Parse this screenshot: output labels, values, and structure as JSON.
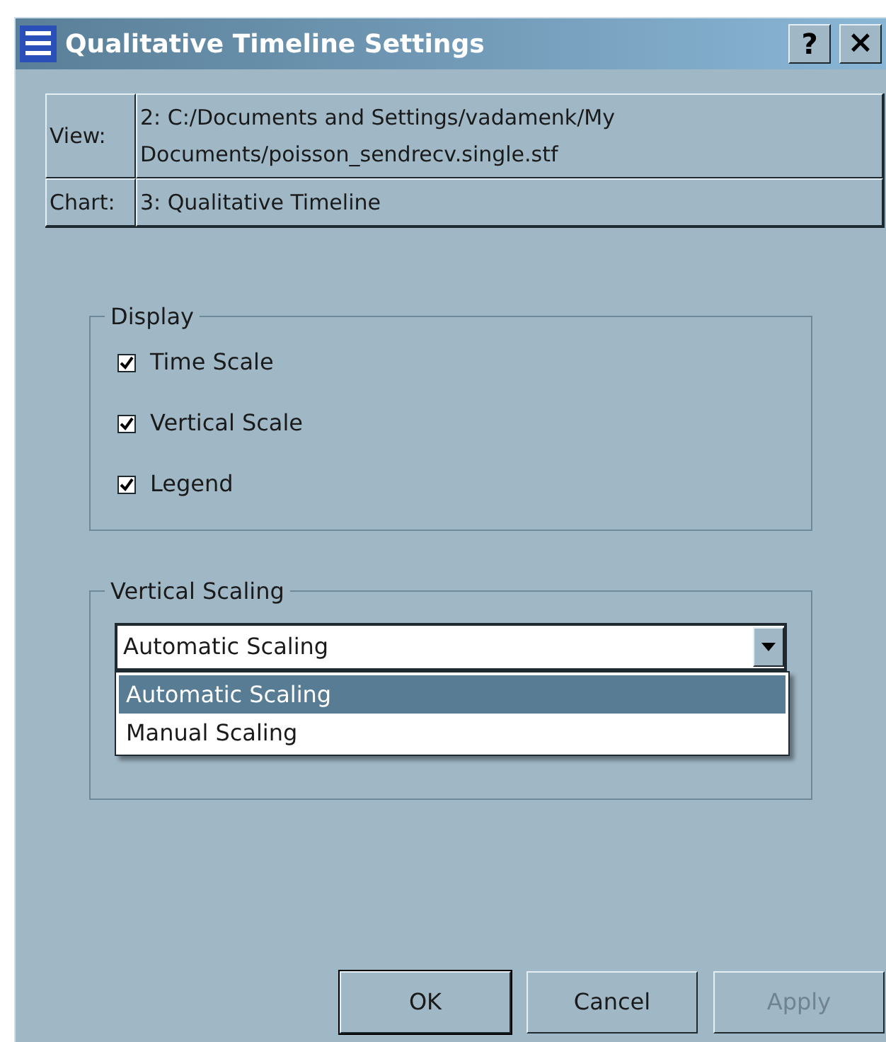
{
  "window": {
    "title": "Qualitative Timeline Settings",
    "help_button": "?",
    "close_button": "×"
  },
  "info": [
    {
      "label": "View:",
      "value": "2: C:/Documents and Settings/vadamenk/My Documents/poisson_sendrecv.single.stf"
    },
    {
      "label": "Chart:",
      "value": "3: Qualitative Timeline"
    }
  ],
  "display": {
    "title": "Display",
    "options": [
      {
        "label": "Time Scale",
        "checked": true
      },
      {
        "label": "Vertical Scale",
        "checked": true
      },
      {
        "label": "Legend",
        "checked": true
      }
    ]
  },
  "vertical_scaling": {
    "title": "Vertical Scaling",
    "value": "Automatic Scaling",
    "expanded": true,
    "options": [
      {
        "label": "Automatic Scaling",
        "selected": true
      },
      {
        "label": "Manual Scaling",
        "selected": false
      }
    ]
  },
  "buttons": [
    {
      "label": "OK",
      "default": true,
      "disabled": false
    },
    {
      "label": "Cancel",
      "default": false,
      "disabled": false
    },
    {
      "label": "Apply",
      "default": false,
      "disabled": true
    }
  ]
}
